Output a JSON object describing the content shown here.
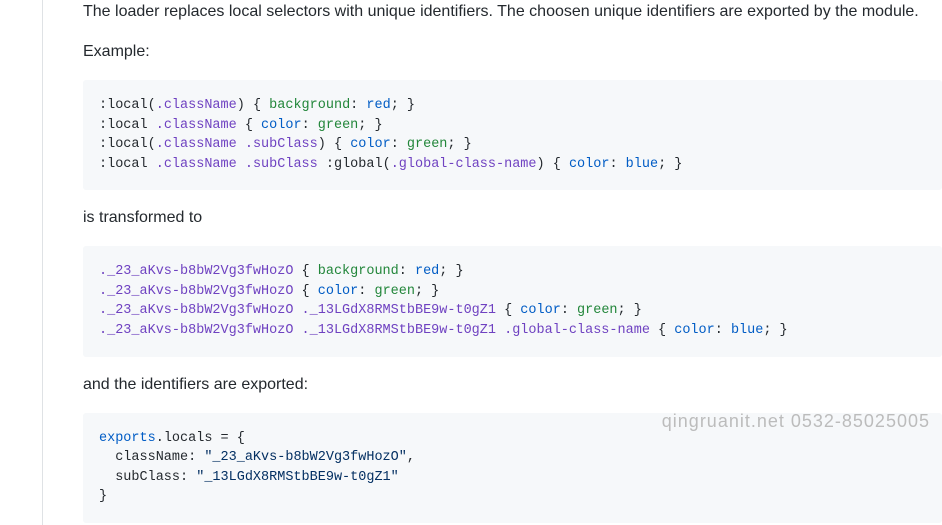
{
  "intro": "The loader replaces local selectors with unique identifiers. The choosen unique identifiers are exported by the module.",
  "example_label": "Example:",
  "code1": {
    "l1": {
      "a": ":local(",
      "cls": ".className",
      "b": ")",
      "brace": " { ",
      "prop": "background",
      "colon": ": ",
      "val": "red",
      "end": "; }"
    },
    "l2": {
      "a": ":local ",
      "cls": ".className",
      "brace": " { ",
      "prop": "color",
      "colon": ": ",
      "val": "green",
      "end": "; }"
    },
    "l3": {
      "a": ":local(",
      "cls": ".className",
      "sp": " ",
      "cls2": ".subClass",
      "b": ")",
      "brace": " { ",
      "prop": "color",
      "colon": ": ",
      "val": "green",
      "end": "; }"
    },
    "l4": {
      "a": ":local ",
      "cls": ".className",
      "sp": " ",
      "cls2": ".subClass",
      "g": " :global(",
      "gcls": ".global-class-name",
      "gb": ")",
      "brace": " { ",
      "prop": "color",
      "colon": ": ",
      "val": "blue",
      "end": "; }"
    }
  },
  "transform_label": "is transformed to",
  "code2": {
    "l1": {
      "cls": "._23_aKvs-b8bW2Vg3fwHozO",
      "brace": " { ",
      "prop": "background",
      "colon": ": ",
      "val": "red",
      "end": "; }"
    },
    "l2": {
      "cls": "._23_aKvs-b8bW2Vg3fwHozO",
      "brace": " { ",
      "prop": "color",
      "colon": ": ",
      "val": "green",
      "end": "; }"
    },
    "l3": {
      "cls": "._23_aKvs-b8bW2Vg3fwHozO",
      "sp": " ",
      "cls2": "._13LGdX8RMStbBE9w-t0gZ1",
      "brace": " { ",
      "prop": "color",
      "colon": ": ",
      "val": "green",
      "end": "; }"
    },
    "l4": {
      "cls": "._23_aKvs-b8bW2Vg3fwHozO",
      "sp": " ",
      "cls2": "._13LGdX8RMStbBE9w-t0gZ1",
      "sp2": " ",
      "gcls": ".global-class-name",
      "brace": " { ",
      "prop": "color",
      "colon": ": ",
      "val": "blue",
      "end": "; }"
    }
  },
  "export_label": "and the identifiers are exported:",
  "code3": {
    "l1": {
      "exp": "exports",
      "dot": ".",
      "loc": "locals",
      "eq": " = {"
    },
    "l2": {
      "pad": "  ",
      "key": "className",
      "colon": ": ",
      "str": "\"_23_aKvs-b8bW2Vg3fwHozO\"",
      "comma": ","
    },
    "l3": {
      "pad": "  ",
      "key": "subClass",
      "colon": ": ",
      "str": "\"_13LGdX8RMStbBE9w-t0gZ1\""
    },
    "l4": {
      "close": "}"
    }
  },
  "watermark": "qingruanit.net 0532-85025005"
}
